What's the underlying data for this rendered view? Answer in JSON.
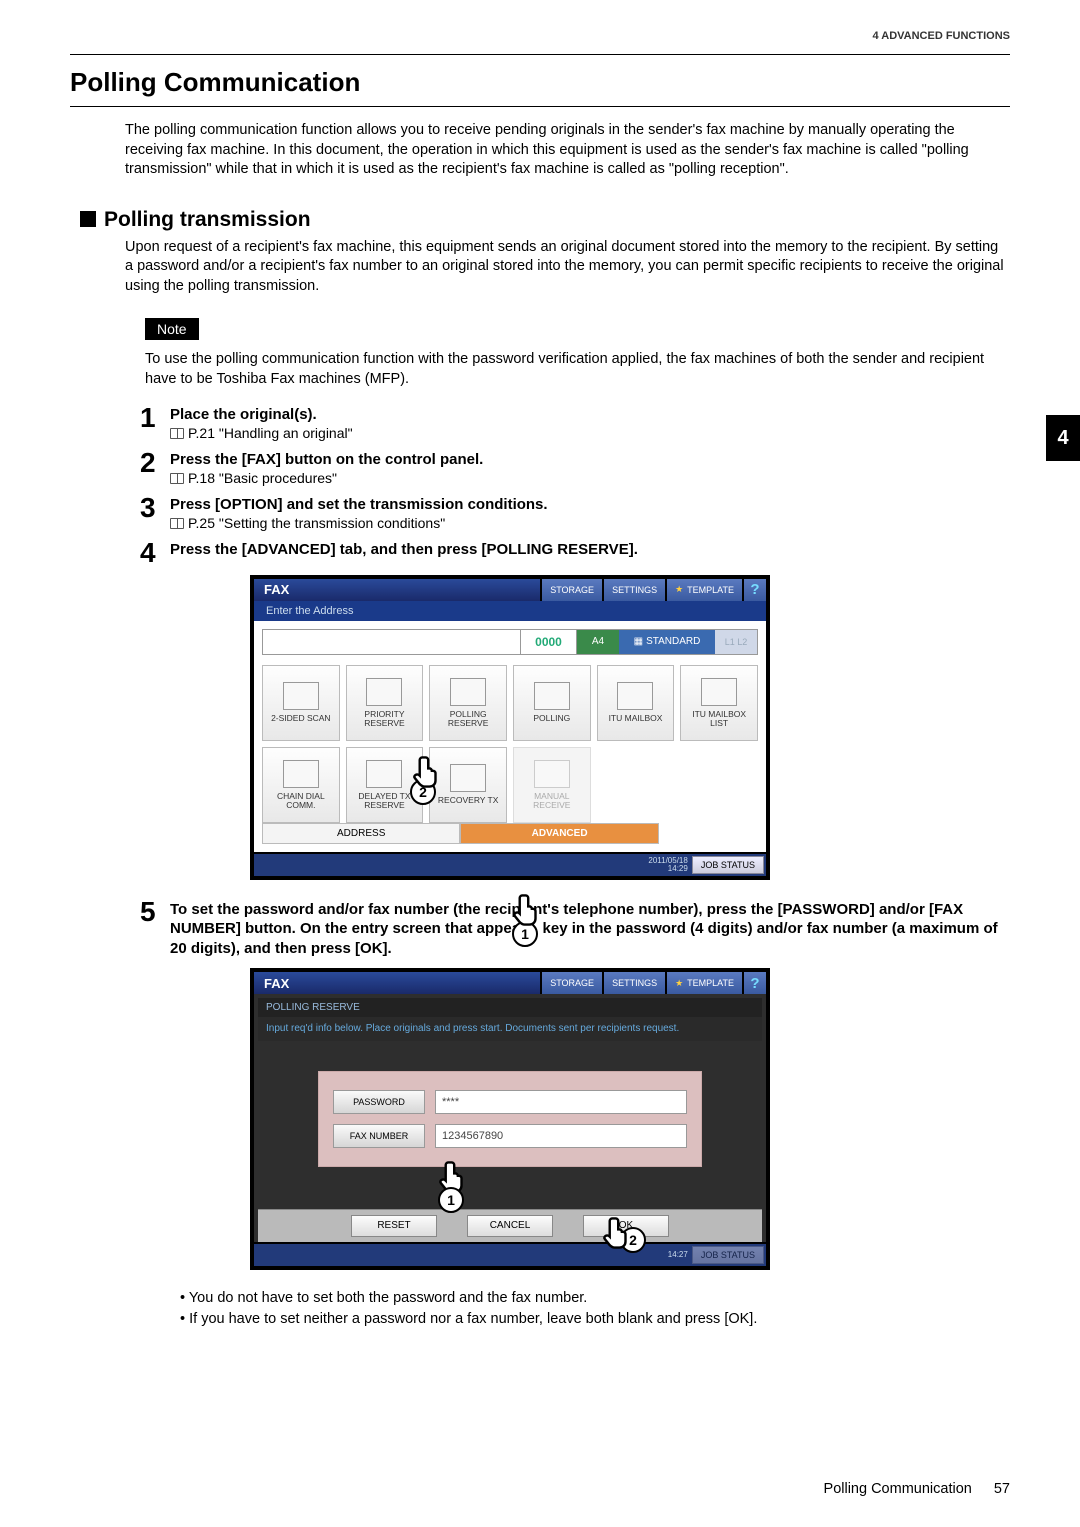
{
  "header": {
    "chapter": "4 ADVANCED FUNCTIONS"
  },
  "sideTab": "4",
  "title": "Polling Communication",
  "intro": "The polling communication function allows you to receive pending originals in the sender's fax machine by manually operating the receiving fax machine. In this document, the operation in which this equipment is used as the sender's fax machine is called \"polling transmission\" while that in which it is used as the recipient's fax machine is called as \"polling reception\".",
  "subtitle": "Polling transmission",
  "subtext": "Upon request of a recipient's fax machine, this equipment sends an original document stored into the memory to the recipient. By setting a password and/or a recipient's fax number to an original stored into the memory, you can permit specific recipients to receive the original using the polling transmission.",
  "noteLabel": "Note",
  "noteText": "To use the polling communication function with the password verification applied, the fax machines of both the sender and recipient have to be Toshiba Fax machines (MFP).",
  "steps": {
    "s1": {
      "num": "1",
      "title": "Place the original(s).",
      "ref": "P.21 \"Handling an original\""
    },
    "s2": {
      "num": "2",
      "title": "Press the [FAX] button on the control panel.",
      "ref": "P.18 \"Basic procedures\""
    },
    "s3": {
      "num": "3",
      "title": "Press [OPTION] and set the transmission conditions.",
      "ref": "P.25 \"Setting the transmission conditions\""
    },
    "s4": {
      "num": "4",
      "title": "Press the [ADVANCED] tab, and then press [POLLING RESERVE]."
    },
    "s5": {
      "num": "5",
      "title": "To set the password and/or fax number (the recipient's telephone number), press the [PASSWORD] and/or [FAX NUMBER] button. On the entry screen that appears, key in the password (4 digits) and/or fax number (a maximum of 20 digits), and then press [OK]."
    }
  },
  "fax1": {
    "title": "FAX",
    "storage": "STORAGE",
    "settings": "SETTINGS",
    "template": "TEMPLATE",
    "help": "?",
    "subbar": "Enter the Address",
    "counter": "0000",
    "paper": "A4",
    "standard": "STANDARD",
    "line": "L1  L2",
    "cells": {
      "c0": "2-SIDED SCAN",
      "c1": "PRIORITY RESERVE",
      "c2": "POLLING RESERVE",
      "c3": "POLLING",
      "c4": "ITU MAILBOX",
      "c5": "ITU MAILBOX LIST",
      "c6": "CHAIN DIAL COMM.",
      "c7": "DELAYED TX RESERVE",
      "c8": "RECOVERY TX",
      "c9": "MANUAL RECEIVE"
    },
    "tabAddress": "ADDRESS",
    "tabAdvanced": "ADVANCED",
    "datetime": "2011/05/18\n14:29",
    "jobstatus": "JOB STATUS",
    "callout1": "1",
    "callout2": "2"
  },
  "fax2": {
    "title": "FAX",
    "storage": "STORAGE",
    "settings": "SETTINGS",
    "template": "TEMPLATE",
    "help": "?",
    "subbar": "POLLING RESERVE",
    "hint": "Input req'd info below. Place originals and press start. Documents sent per recipients request.",
    "passwordLabel": "PASSWORD",
    "passwordValue": "****",
    "faxnumLabel": "FAX NUMBER",
    "faxnumValue": "1234567890",
    "reset": "RESET",
    "cancel": "CANCEL",
    "ok": "OK",
    "datetime": "14:27",
    "jobstatus": "JOB STATUS",
    "callout1": "1",
    "callout2": "2"
  },
  "bullets": {
    "b1": "You do not have to set both the password and the fax number.",
    "b2": "If you have to set neither a password nor a fax number, leave both blank and press [OK]."
  },
  "footer": {
    "label": "Polling Communication",
    "page": "57"
  }
}
